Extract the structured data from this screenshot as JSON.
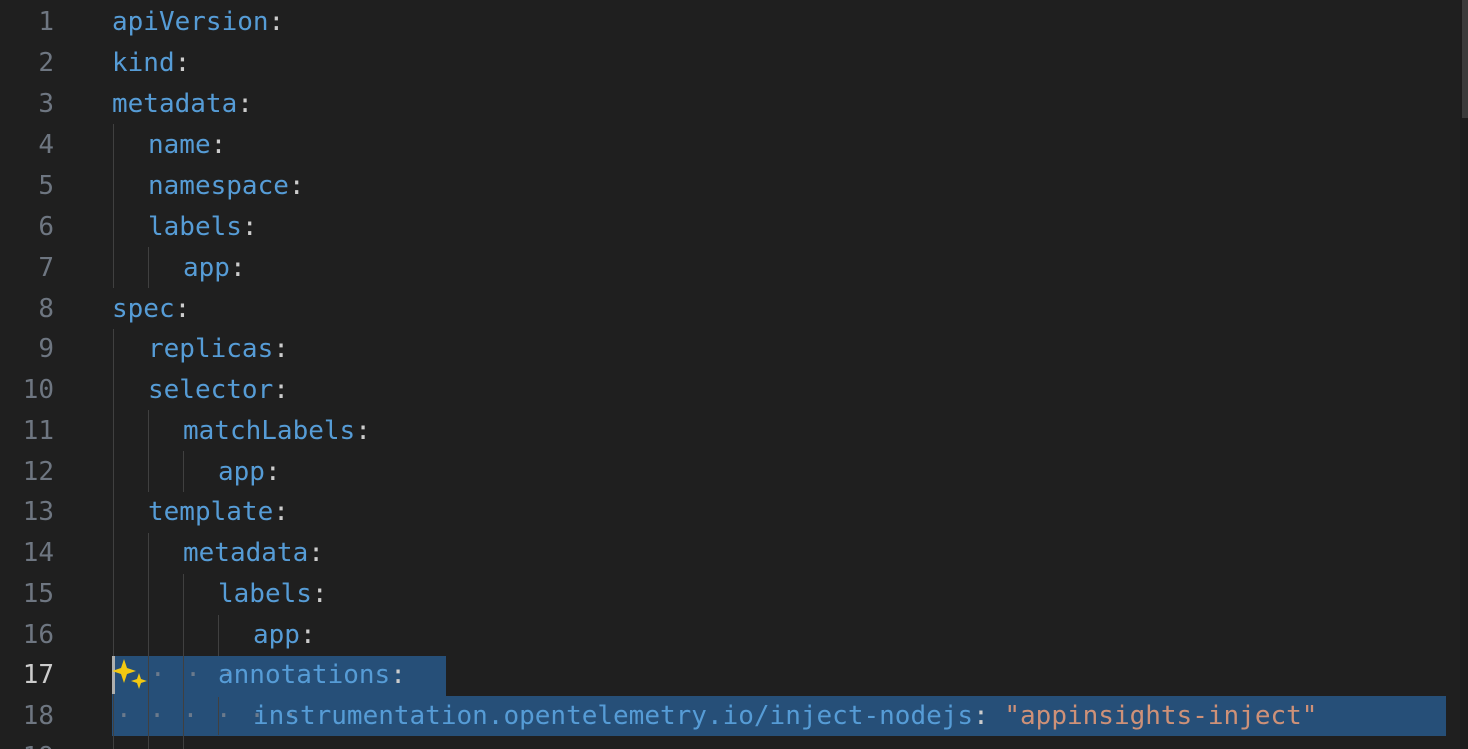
{
  "editor": {
    "language": "yaml",
    "active_line": "17",
    "lines": [
      {
        "num": "1",
        "text": "apiVersion"
      },
      {
        "num": "2",
        "text": "kind"
      },
      {
        "num": "3",
        "text": "metadata"
      },
      {
        "num": "4",
        "text": "name"
      },
      {
        "num": "5",
        "text": "namespace"
      },
      {
        "num": "6",
        "text": "labels"
      },
      {
        "num": "7",
        "text": "app"
      },
      {
        "num": "8",
        "text": "spec"
      },
      {
        "num": "9",
        "text": "replicas"
      },
      {
        "num": "10",
        "text": "selector"
      },
      {
        "num": "11",
        "text": "matchLabels"
      },
      {
        "num": "12",
        "text": "app"
      },
      {
        "num": "13",
        "text": "template"
      },
      {
        "num": "14",
        "text": "metadata"
      },
      {
        "num": "15",
        "text": "labels"
      },
      {
        "num": "16",
        "text": "app"
      },
      {
        "num": "17",
        "text": "annotations"
      },
      {
        "num": "18",
        "text": "instrumentation.opentelemetry.io/inject-nodejs",
        "value": "\"appinsights-inject\""
      }
    ],
    "colon": ":"
  },
  "colors": {
    "background": "#1f1f1f",
    "key": "#569cd6",
    "string": "#ce9178",
    "line_number": "#6e7681",
    "selection": "#264f78"
  },
  "icons": {
    "inline_chat": "sparkle-icon"
  }
}
